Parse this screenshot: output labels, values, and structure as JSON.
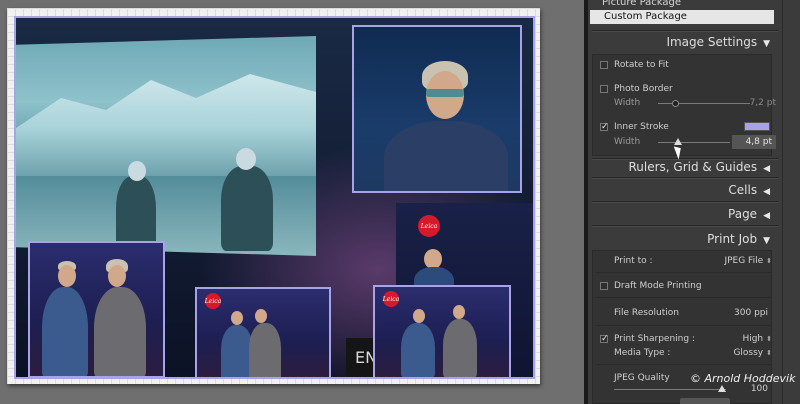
{
  "template_browser": {
    "items": [
      {
        "label": "Picture Package",
        "selected": false
      },
      {
        "label": "Custom Package",
        "selected": true
      }
    ]
  },
  "image_settings": {
    "title": "Image Settings",
    "rotate_to_fit": {
      "label": "Rotate to Fit",
      "checked": false
    },
    "photo_border": {
      "label": "Photo Border",
      "checked": false,
      "width_label": "Width",
      "width_value": "7,2 pt"
    },
    "inner_stroke": {
      "label": "Inner Stroke",
      "checked": true,
      "width_label": "Width",
      "width_value": "4,8 pt",
      "color": "#a8a3e6"
    }
  },
  "sections": {
    "rulers": "Rulers, Grid & Guides",
    "cells": "Cells",
    "page": "Page",
    "print_job": "Print Job"
  },
  "print_job": {
    "print_to_label": "Print to :",
    "print_to_value": "JPEG File",
    "draft_mode": {
      "label": "Draft Mode Printing",
      "checked": false
    },
    "file_resolution_label": "File Resolution",
    "file_resolution_value": "300 ppi",
    "print_sharpening": {
      "label": "Print Sharpening :",
      "checked": true,
      "value": "High"
    },
    "media_type_label": "Media Type :",
    "media_type_value": "Glossy",
    "jpeg_quality_label": "JPEG Quality",
    "jpeg_quality_value": "100"
  },
  "copyright": "© Arnold Hoddevik",
  "photo_text": {
    "leica": "Leica",
    "stage_sign": "EN"
  },
  "colors": {
    "stroke": "#a8a3e6",
    "panel": "#3b3b3b",
    "selected": "#e6e6e6"
  }
}
